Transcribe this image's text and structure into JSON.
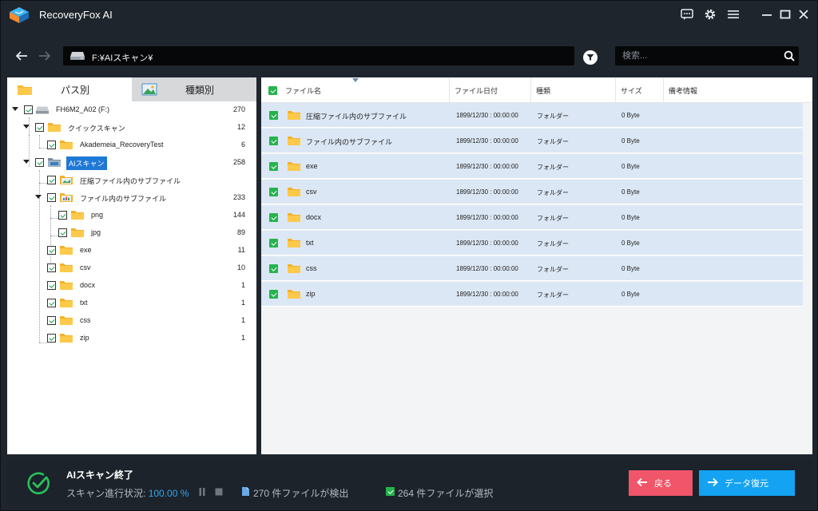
{
  "app": {
    "title": "RecoveryFox AI"
  },
  "titlebar": {
    "icons": [
      "feedback-icon",
      "settings-icon",
      "menu-icon",
      "minimize-icon",
      "maximize-icon",
      "close-icon"
    ]
  },
  "toolbar": {
    "path": "F:¥AIスキャン¥",
    "search_placeholder": "検索..."
  },
  "left_tabs": [
    {
      "label": "パス別",
      "active": true
    },
    {
      "label": "種類別",
      "active": false
    }
  ],
  "tree": [
    {
      "label": "FH6M2_A02 (F:)",
      "count": "270"
    },
    {
      "label": "クイックスキャン",
      "count": "12"
    },
    {
      "label": "Akademeia_RecoveryTest",
      "count": "6"
    },
    {
      "label": "AIスキャン",
      "count": "258"
    },
    {
      "label": "圧縮ファイル内のサブファイル",
      "count": ""
    },
    {
      "label": "ファイル内のサブファイル",
      "count": "233"
    },
    {
      "label": "png",
      "count": "144"
    },
    {
      "label": "jpg",
      "count": "89"
    },
    {
      "label": "exe",
      "count": "11"
    },
    {
      "label": "csv",
      "count": "10"
    },
    {
      "label": "docx",
      "count": "1"
    },
    {
      "label": "txt",
      "count": "1"
    },
    {
      "label": "css",
      "count": "1"
    },
    {
      "label": "zip",
      "count": "1"
    }
  ],
  "table": {
    "columns": [
      "ファイル名",
      "ファイル日付",
      "種類",
      "サイズ",
      "備考情報"
    ],
    "rows": [
      {
        "name": "圧縮ファイル内のサブファイル",
        "date": "1899/12/30 : 00:00:00",
        "type": "フォルダー",
        "size": "0 Byte",
        "note": ""
      },
      {
        "name": "ファイル内のサブファイル",
        "date": "1899/12/30 : 00:00:00",
        "type": "フォルダー",
        "size": "0 Byte",
        "note": ""
      },
      {
        "name": "exe",
        "date": "1899/12/30 : 00:00:00",
        "type": "フォルダー",
        "size": "0 Byte",
        "note": ""
      },
      {
        "name": "csv",
        "date": "1899/12/30 : 00:00:00",
        "type": "フォルダー",
        "size": "0 Byte",
        "note": ""
      },
      {
        "name": "docx",
        "date": "1899/12/30 : 00:00:00",
        "type": "フォルダー",
        "size": "0 Byte",
        "note": ""
      },
      {
        "name": "txt",
        "date": "1899/12/30 : 00:00:00",
        "type": "フォルダー",
        "size": "0 Byte",
        "note": ""
      },
      {
        "name": "css",
        "date": "1899/12/30 : 00:00:00",
        "type": "フォルダー",
        "size": "0 Byte",
        "note": ""
      },
      {
        "name": "zip",
        "date": "1899/12/30 : 00:00:00",
        "type": "フォルダー",
        "size": "0 Byte",
        "note": ""
      }
    ]
  },
  "status": {
    "title": "AIスキャン終了",
    "progress_label": "スキャン進行状況:",
    "progress_value": "100.00 %",
    "found": "270 件ファイルが検出",
    "selected": "264 件ファイルが選択"
  },
  "buttons": {
    "back": "戻る",
    "recover": "データ復元"
  },
  "colors": {
    "background": "#1e252d",
    "accent_blue": "#13a3f2",
    "back_red": "#f0556a",
    "check_green": "#26b34e",
    "row_highlight": "#dce7f5"
  }
}
